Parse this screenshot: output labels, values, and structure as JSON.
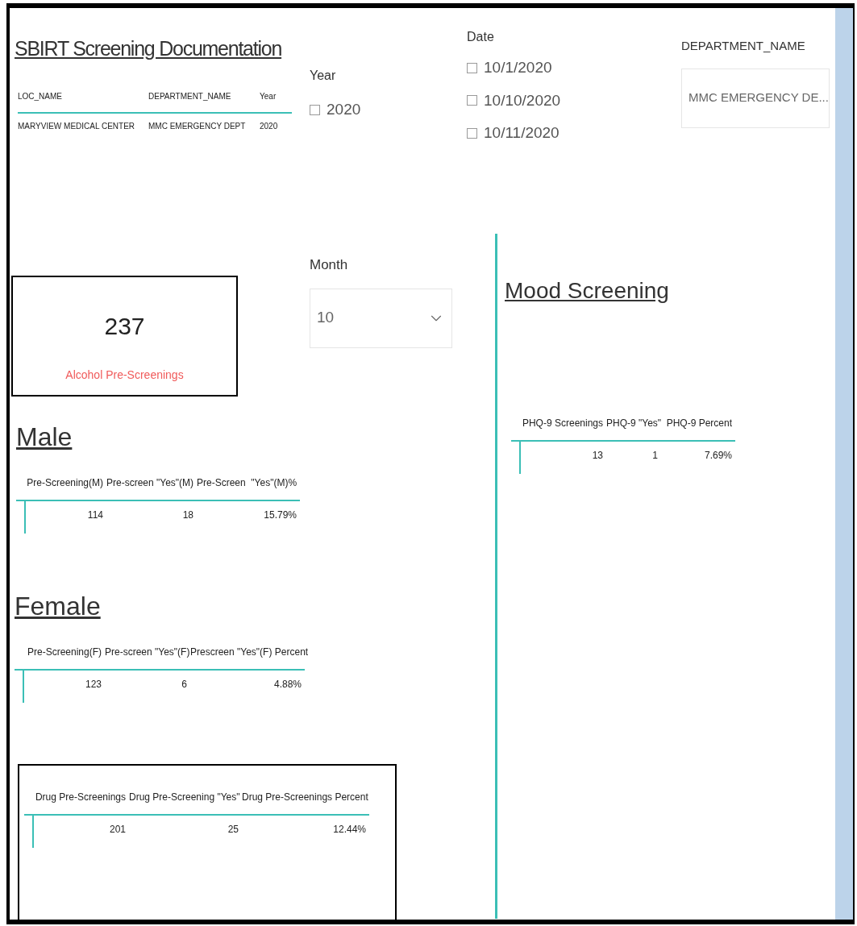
{
  "title": "SBIRT Screening Documentation",
  "location_table": {
    "columns": [
      "LOC_NAME",
      "DEPARTMENT_NAME",
      "Year"
    ],
    "rows": [
      [
        "MARYVIEW MEDICAL CENTER",
        "MMC EMERGENCY DEPT",
        "2020"
      ]
    ]
  },
  "year_slicer": {
    "label": "Year",
    "items": [
      {
        "label": "2020",
        "checked": false
      }
    ]
  },
  "date_slicer": {
    "label": "Date",
    "items": [
      {
        "label": "10/1/2020",
        "checked": false
      },
      {
        "label": "10/10/2020",
        "checked": false
      },
      {
        "label": "10/11/2020",
        "checked": false
      }
    ]
  },
  "department_slicer": {
    "label": "DEPARTMENT_NAME",
    "value": "MMC EMERGENCY DE..."
  },
  "month_slicer": {
    "label": "Month",
    "value": "10"
  },
  "card": {
    "value": "237",
    "label": "Alcohol Pre-Screenings"
  },
  "male": {
    "heading": "Male",
    "columns": [
      "Pre-Screening(M)",
      "Pre-screen \"Yes\"(M)",
      "Pre-Screen  \"Yes\"(M)%"
    ],
    "rows": [
      [
        "114",
        "18",
        "15.79%"
      ]
    ]
  },
  "female": {
    "heading": "Female",
    "columns": [
      "Pre-Screening(F)",
      "Pre-screen \"Yes\"(F)",
      "Prescreen \"Yes\"(F) Percent"
    ],
    "rows": [
      [
        "123",
        "6",
        "4.88%"
      ]
    ]
  },
  "drug_table": {
    "columns": [
      "Drug Pre-Screenings",
      "Drug Pre-Screening \"Yes\"",
      "Drug Pre-Screenings Percent"
    ],
    "rows": [
      [
        "201",
        "25",
        "12.44%"
      ]
    ]
  },
  "mood": {
    "heading": "Mood Screening",
    "columns": [
      "PHQ-9 Screenings",
      "PHQ-9 \"Yes\"",
      "PHQ-9 Percent"
    ],
    "rows": [
      [
        "13",
        "1",
        "7.69%"
      ]
    ]
  }
}
